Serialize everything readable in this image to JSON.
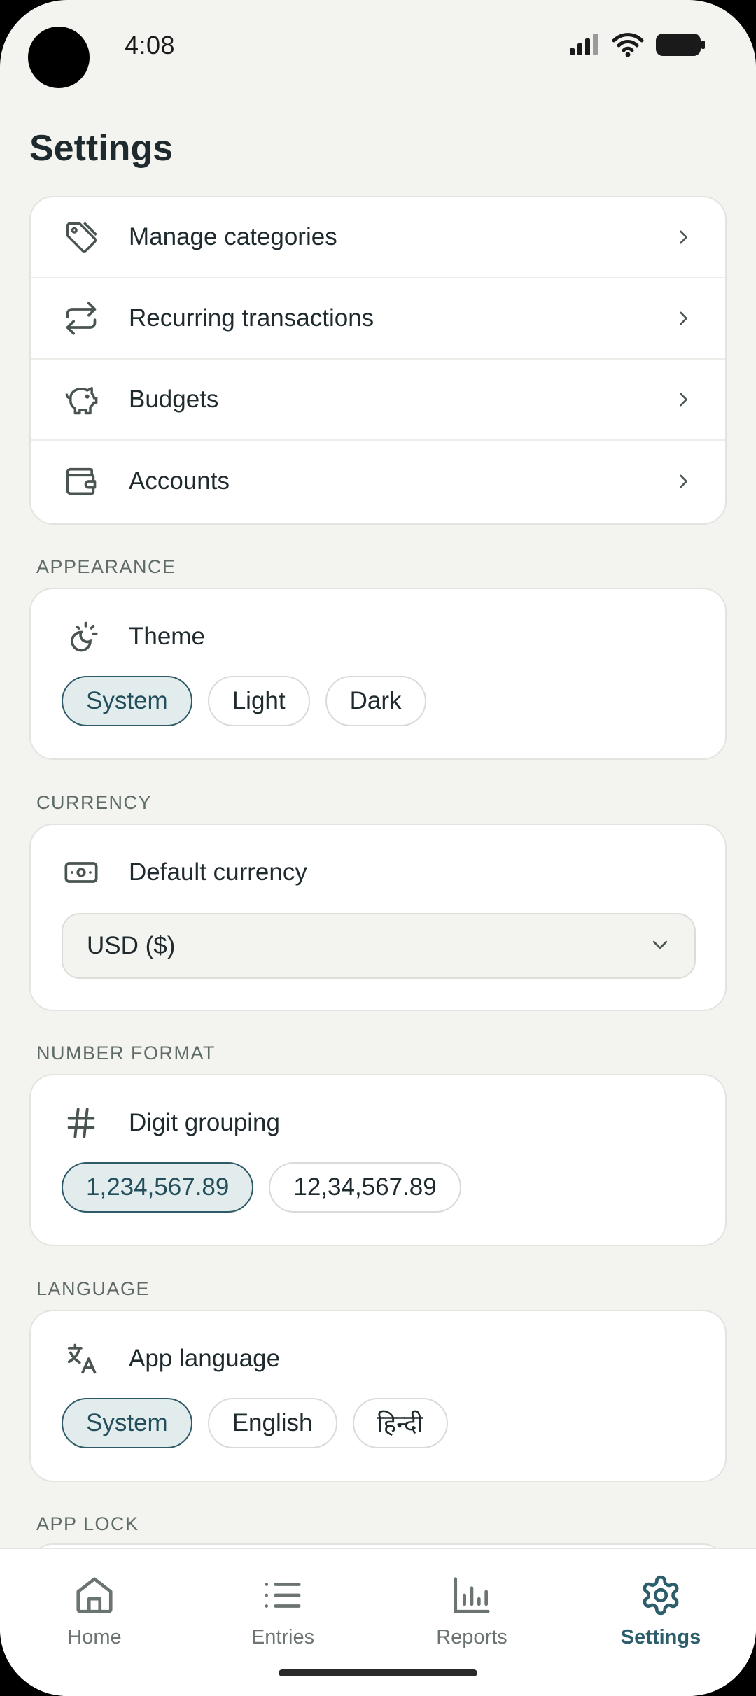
{
  "status_bar": {
    "time": "4:08"
  },
  "page": {
    "title": "Settings"
  },
  "menu": {
    "items": [
      {
        "label": "Manage categories",
        "icon": "tag-icon"
      },
      {
        "label": "Recurring transactions",
        "icon": "repeat-icon"
      },
      {
        "label": "Budgets",
        "icon": "piggy-bank-icon"
      },
      {
        "label": "Accounts",
        "icon": "wallet-icon"
      }
    ]
  },
  "appearance": {
    "section": "APPEARANCE",
    "title": "Theme",
    "options": [
      "System",
      "Light",
      "Dark"
    ],
    "selected": "System"
  },
  "currency": {
    "section": "CURRENCY",
    "title": "Default currency",
    "value": "USD ($)"
  },
  "number_format": {
    "section": "NUMBER FORMAT",
    "title": "Digit grouping",
    "options": [
      "1,234,567.89",
      "12,34,567.89"
    ],
    "selected": "1,234,567.89"
  },
  "language": {
    "section": "LANGUAGE",
    "title": "App language",
    "options": [
      "System",
      "English",
      "हिन्दी"
    ],
    "selected": "System"
  },
  "app_lock": {
    "section": "APP LOCK"
  },
  "bottom_nav": {
    "items": [
      {
        "label": "Home",
        "icon": "home-icon"
      },
      {
        "label": "Entries",
        "icon": "list-icon"
      },
      {
        "label": "Reports",
        "icon": "bar-chart-icon"
      },
      {
        "label": "Settings",
        "icon": "gear-icon"
      }
    ],
    "active": "Settings"
  },
  "colors": {
    "background": "#f3f3ef",
    "card": "#ffffff",
    "accent": "#2b5d6b",
    "chip_selected_bg": "#e3ecec",
    "text": "#1f2a2e",
    "muted": "#5f6b66"
  }
}
